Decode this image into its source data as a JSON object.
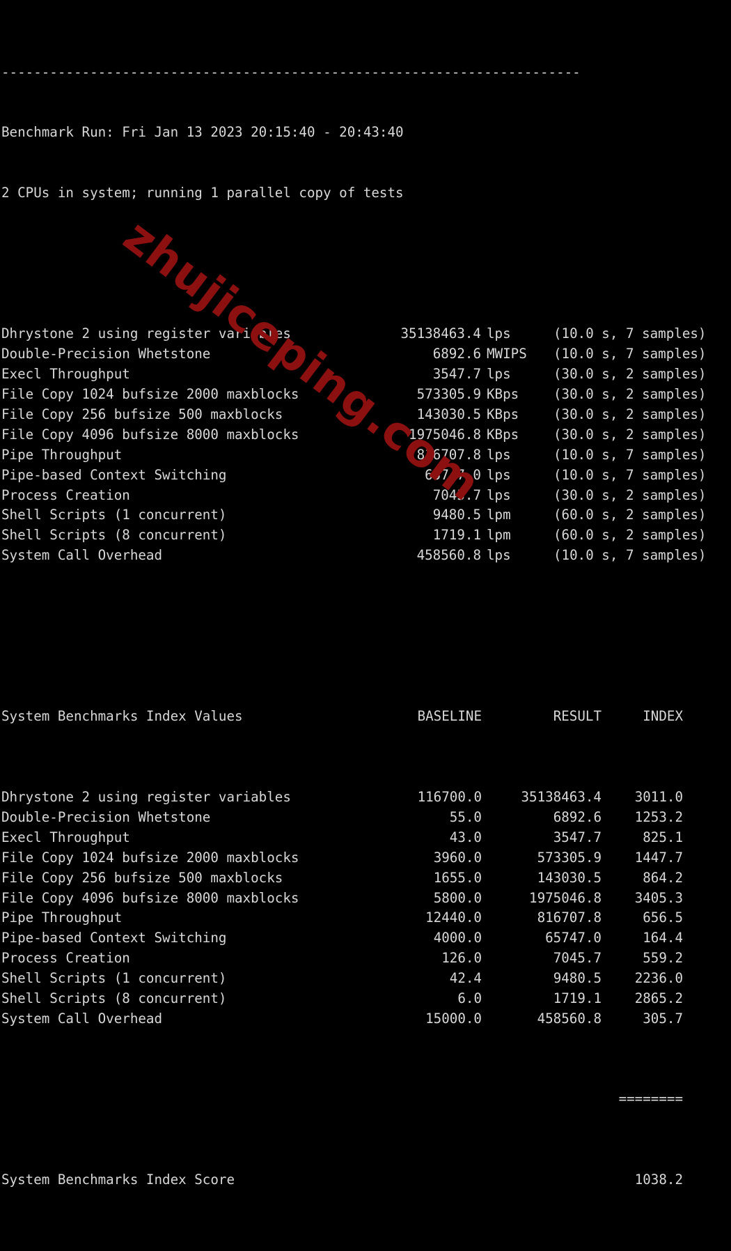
{
  "terminal": {
    "divider": "------------------------------------------------------------------------",
    "benchmark_run": "Benchmark Run: Fri Jan 13 2023 20:15:40 - 20:43:40",
    "cpu_info": "2 CPUs in system; running 1 parallel copy of tests",
    "separator_equals": "========",
    "background_color": "#000000",
    "text_color": "#d8d8d8"
  },
  "watermark": {
    "text": "zhujiceping.com",
    "color": "#8c1010"
  },
  "results": [
    {
      "name": "Dhrystone 2 using register variables",
      "value": "35138463.4",
      "unit": "lps",
      "samples": "(10.0 s, 7 samples)"
    },
    {
      "name": "Double-Precision Whetstone",
      "value": "6892.6",
      "unit": "MWIPS",
      "samples": "(10.0 s, 7 samples)"
    },
    {
      "name": "Execl Throughput",
      "value": "3547.7",
      "unit": "lps",
      "samples": "(30.0 s, 2 samples)"
    },
    {
      "name": "File Copy 1024 bufsize 2000 maxblocks",
      "value": "573305.9",
      "unit": "KBps",
      "samples": "(30.0 s, 2 samples)"
    },
    {
      "name": "File Copy 256 bufsize 500 maxblocks",
      "value": "143030.5",
      "unit": "KBps",
      "samples": "(30.0 s, 2 samples)"
    },
    {
      "name": "File Copy 4096 bufsize 8000 maxblocks",
      "value": "1975046.8",
      "unit": "KBps",
      "samples": "(30.0 s, 2 samples)"
    },
    {
      "name": "Pipe Throughput",
      "value": "816707.8",
      "unit": "lps",
      "samples": "(10.0 s, 7 samples)"
    },
    {
      "name": "Pipe-based Context Switching",
      "value": "65747.0",
      "unit": "lps",
      "samples": "(10.0 s, 7 samples)"
    },
    {
      "name": "Process Creation",
      "value": "7045.7",
      "unit": "lps",
      "samples": "(30.0 s, 2 samples)"
    },
    {
      "name": "Shell Scripts (1 concurrent)",
      "value": "9480.5",
      "unit": "lpm",
      "samples": "(60.0 s, 2 samples)"
    },
    {
      "name": "Shell Scripts (8 concurrent)",
      "value": "1719.1",
      "unit": "lpm",
      "samples": "(60.0 s, 2 samples)"
    },
    {
      "name": "System Call Overhead",
      "value": "458560.8",
      "unit": "lps",
      "samples": "(10.0 s, 7 samples)"
    }
  ],
  "index_table": {
    "title": "System Benchmarks Index Values",
    "headers": {
      "baseline": "BASELINE",
      "result": "RESULT",
      "index": "INDEX"
    },
    "rows": [
      {
        "name": "Dhrystone 2 using register variables",
        "baseline": "116700.0",
        "result": "35138463.4",
        "index": "3011.0"
      },
      {
        "name": "Double-Precision Whetstone",
        "baseline": "55.0",
        "result": "6892.6",
        "index": "1253.2"
      },
      {
        "name": "Execl Throughput",
        "baseline": "43.0",
        "result": "3547.7",
        "index": "825.1"
      },
      {
        "name": "File Copy 1024 bufsize 2000 maxblocks",
        "baseline": "3960.0",
        "result": "573305.9",
        "index": "1447.7"
      },
      {
        "name": "File Copy 256 bufsize 500 maxblocks",
        "baseline": "1655.0",
        "result": "143030.5",
        "index": "864.2"
      },
      {
        "name": "File Copy 4096 bufsize 8000 maxblocks",
        "baseline": "5800.0",
        "result": "1975046.8",
        "index": "3405.3"
      },
      {
        "name": "Pipe Throughput",
        "baseline": "12440.0",
        "result": "816707.8",
        "index": "656.5"
      },
      {
        "name": "Pipe-based Context Switching",
        "baseline": "4000.0",
        "result": "65747.0",
        "index": "164.4"
      },
      {
        "name": "Process Creation",
        "baseline": "126.0",
        "result": "7045.7",
        "index": "559.2"
      },
      {
        "name": "Shell Scripts (1 concurrent)",
        "baseline": "42.4",
        "result": "9480.5",
        "index": "2236.0"
      },
      {
        "name": "Shell Scripts (8 concurrent)",
        "baseline": "6.0",
        "result": "1719.1",
        "index": "2865.2"
      },
      {
        "name": "System Call Overhead",
        "baseline": "15000.0",
        "result": "458560.8",
        "index": "305.7"
      }
    ],
    "score_label": "System Benchmarks Index Score",
    "score_value": "1038.2"
  }
}
